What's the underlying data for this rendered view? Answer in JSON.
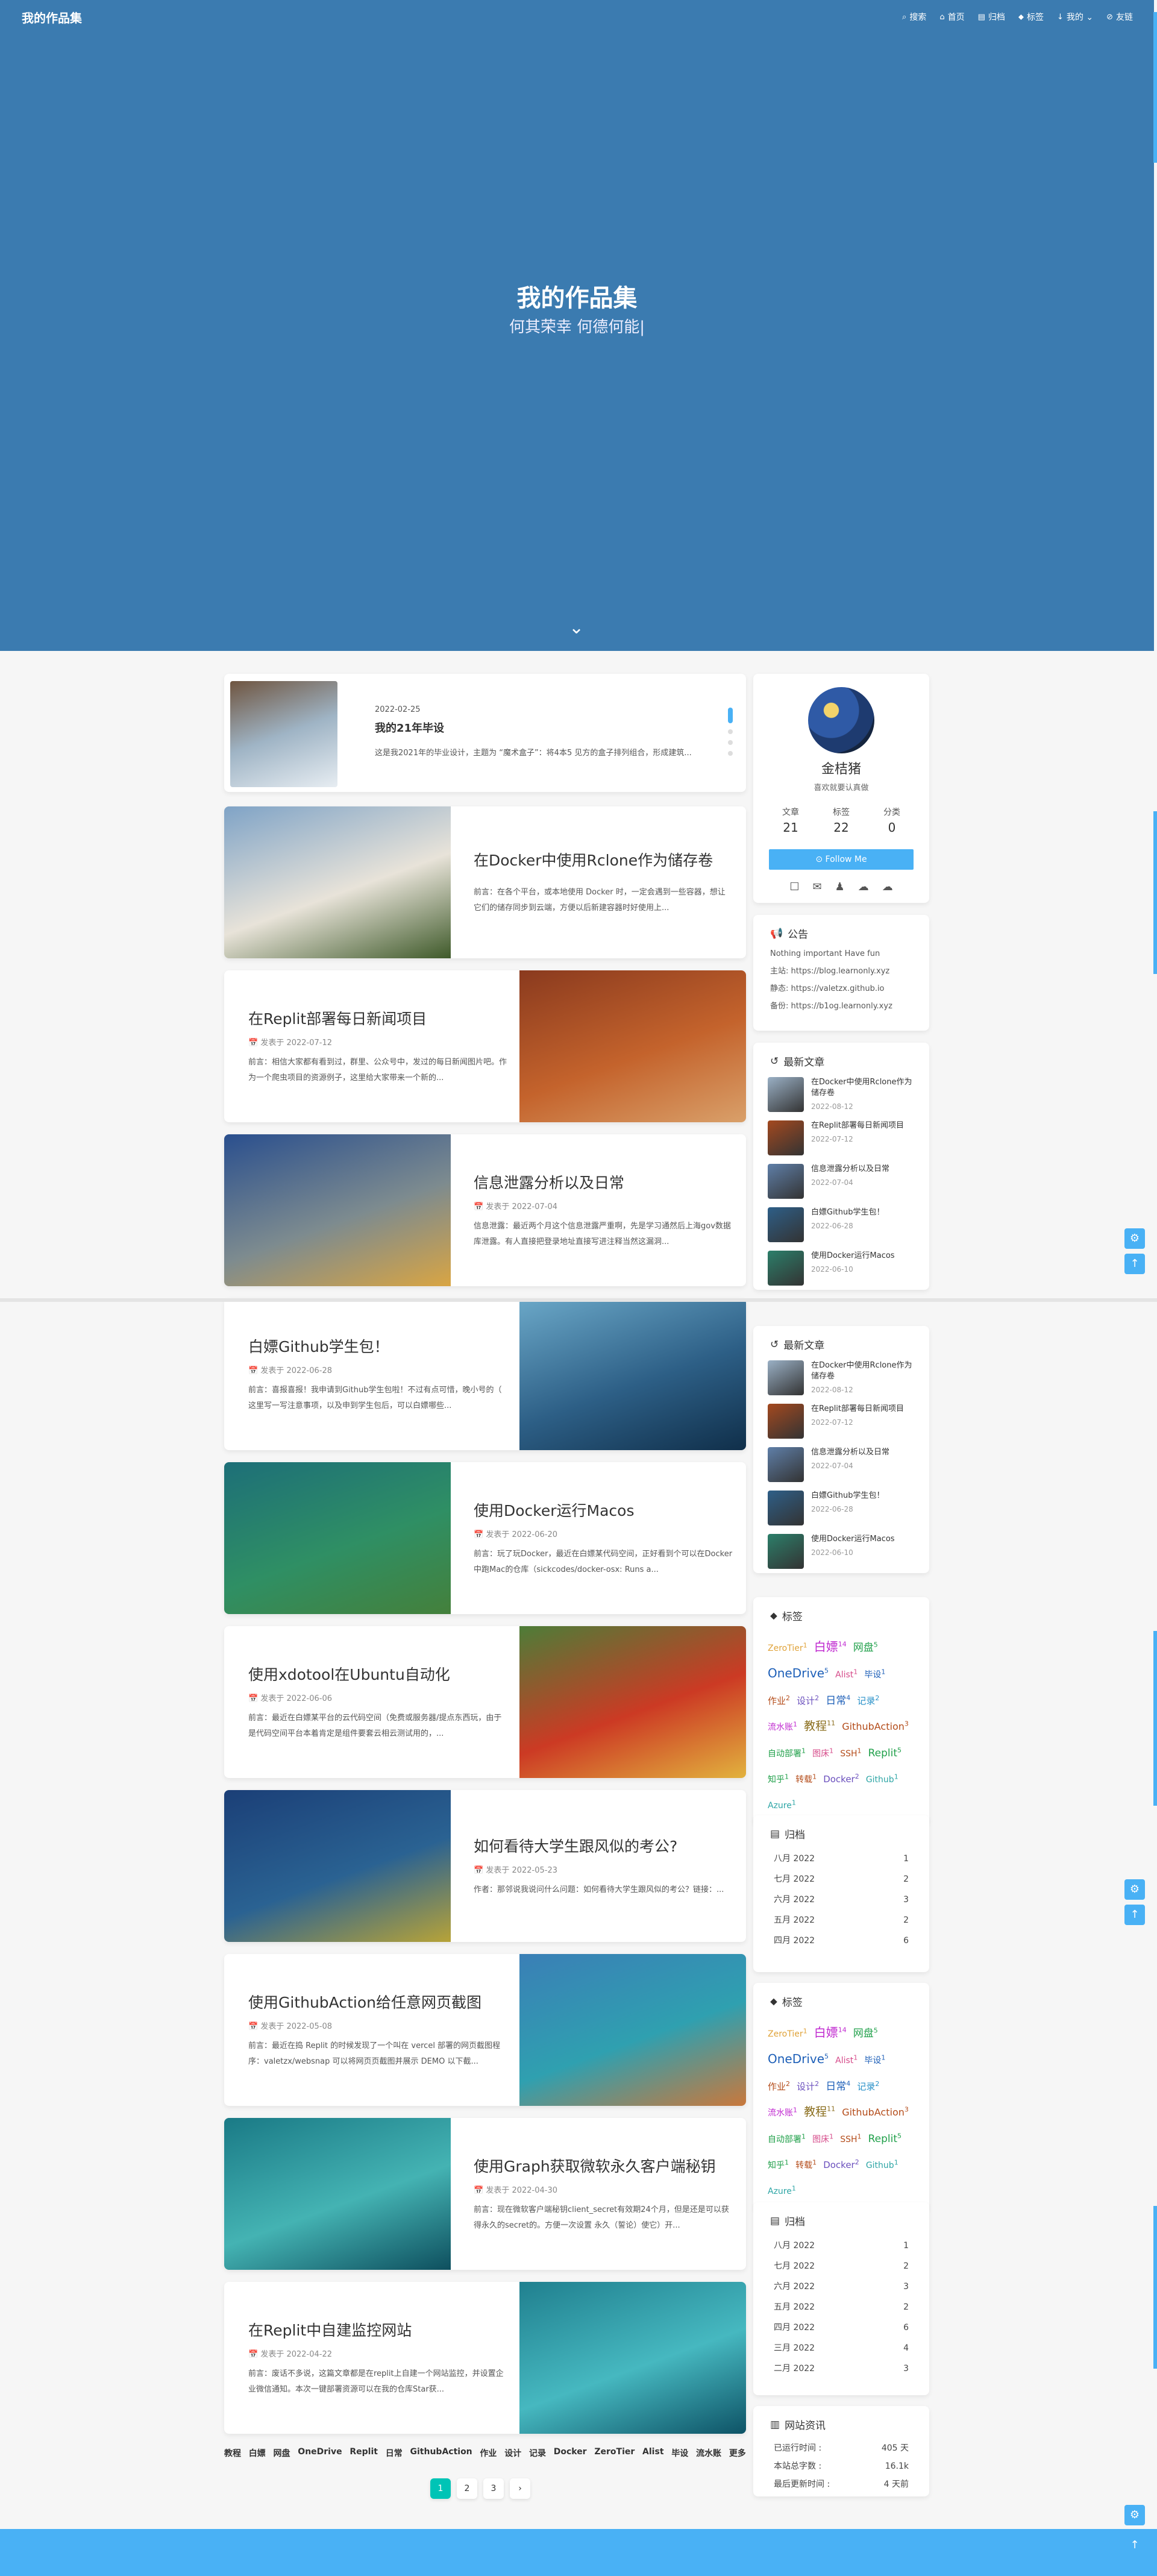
{
  "site": {
    "brand": "我的作品集"
  },
  "nav": [
    {
      "icon": "⌕",
      "label": "搜索"
    },
    {
      "icon": "⌂",
      "label": "首页"
    },
    {
      "icon": "▤",
      "label": "归档"
    },
    {
      "icon": "⬥",
      "label": "标签"
    },
    {
      "icon": "↓",
      "label": "我的 ⌄"
    },
    {
      "icon": "⊘",
      "label": "友链"
    }
  ],
  "hero": {
    "title": "我的作品集",
    "subtitle": "何其荣幸 何德何能|",
    "down_icon": "⌄"
  },
  "sticky": {
    "date": "2022-02-25",
    "title": "我的21年毕设",
    "excerpt": "这是我2021年的毕业设计，主题为 “魔术盒子”：将4本5 见方的盒子排列组合，形成建筑..."
  },
  "posts": [
    {
      "title": "在Docker中使用Rclone作为储存卷",
      "meta": "",
      "excerpt": "前言：在各个平台，或本地使用 Docker 时，一定会遇到一些容器，想让它们的储存同步到云端，方便以后新建容器时好使用上...",
      "colors": [
        "#7fa3c6",
        "#e8e3d9",
        "#3f5a2a"
      ]
    },
    {
      "title": "在Replit部署每日新闻项目",
      "meta": "📅 发表于 2022-07-12",
      "excerpt": "前言：相信大家都有看到过，群里、公众号中，发过的每日新闻图片吧。作为一个爬虫项目的资源例子，这里给大家带来一个新的...",
      "colors": [
        "#8a3a1e",
        "#c4632c",
        "#d9a06a"
      ]
    },
    {
      "title": "信息泄露分析以及日常",
      "meta": "📅 发表于 2022-07-04",
      "excerpt": "信息泄露：最近两个月这个信息泄露严重啊，先是学习通然后上海gov数据库泄露。有人直接把登录地址直接写进注释当然这漏洞...",
      "colors": [
        "#2a4f8e",
        "#7d8b8f",
        "#d9a543"
      ]
    },
    {
      "title": "白嫖Github学生包！",
      "meta": "📅 发表于 2022-06-28",
      "excerpt": "前言：喜报喜报！我申请到Github学生包啦！不过有点可惜，晚小号的（ 这里写一写注意事项，以及申到学生包后，可以白嫖哪些...",
      "colors": [
        "#6ba8c8",
        "#2d5f86",
        "#102f4a"
      ]
    },
    {
      "title": "使用Docker运行Macos",
      "meta": "📅 发表于 2022-06-20",
      "excerpt": "前言：玩了玩Docker，最近在白嫖某代码空间，正好看到个可以在Docker中跑Mac的仓库（sickcodes/docker-osx: Runs a...",
      "colors": [
        "#1d6f78",
        "#2f8f64",
        "#44803b"
      ]
    },
    {
      "title": "使用xdotool在Ubuntu自动化",
      "meta": "📅 发表于 2022-06-06",
      "excerpt": "前言：最近在白嫖某平台的云代码空间（免费或服务器/提点东西玩，由于是代码空间平台本着肯定是组件要套云相云测试用的，...",
      "colors": [
        "#4d7d38",
        "#cc3a24",
        "#e2b23e"
      ]
    },
    {
      "title": "如何看待大学生跟风似的考公?",
      "meta": "📅 发表于 2022-05-23",
      "excerpt": "作者：那邻说我说问什么问题：如何看待大学生跟风似的考公？链接：...",
      "colors": [
        "#1b3f77",
        "#2a6292",
        "#b7a338"
      ]
    },
    {
      "title": "使用GithubAction给任意网页截图",
      "meta": "📅 发表于 2022-05-08",
      "excerpt": "前言：最近在捣 Replit 的时候发现了一个叫在 vercel 部署的网页截图程序：valetzx/websnap 可以将网页页截图并展示 DEMO 以下截...",
      "colors": [
        "#3a7fb6",
        "#2fa0b0",
        "#c9783c"
      ]
    },
    {
      "title": "使用Graph获取微软永久客户端秘钥",
      "meta": "📅 发表于 2022-04-30",
      "excerpt": "前言：现在微软客户端秘钥client_secret有效期24个月，但是还是可以获得永久的secret的。方便一次设置 永久（誓论）使它）开...",
      "colors": [
        "#1a7a86",
        "#44b3b3",
        "#0e4f5e"
      ]
    },
    {
      "title": "在Replit中自建监控网站",
      "meta": "📅 发表于 2022-04-22",
      "excerpt": "前言：废话不多说，这篇文章都是在replit上自建一个网站监控，并设置企业微信通知。本次一键部署资源可以在我的仓库Star获...",
      "colors": [
        "#20808f",
        "#46b8c0",
        "#0e5366"
      ]
    }
  ],
  "author": {
    "name": "金桔猪",
    "desc": "喜欢就要认真做",
    "stats": [
      {
        "k": "文章",
        "v": "21"
      },
      {
        "k": "标签",
        "v": "22"
      },
      {
        "k": "分类",
        "v": "0"
      }
    ],
    "follow": "⊙ Follow Me",
    "socials": [
      "☐",
      "✉",
      "♟",
      "☁",
      "☁"
    ]
  },
  "announce": {
    "head": "公告",
    "lines": [
      "Nothing important Have fun",
      "主站: https://blog.learnonly.xyz",
      "静态: https://valetzx.github.io",
      "备份: https://b1og.learnonly.xyz"
    ]
  },
  "recent": {
    "head": "最新文章",
    "items": [
      {
        "title": "在Docker中使用Rclone作为储存卷",
        "date": "2022-08-12",
        "color": "#9ab0c5"
      },
      {
        "title": "在Replit部署每日新闻项目",
        "date": "2022-07-12",
        "color": "#a4491f"
      },
      {
        "title": "信息泄露分析以及日常",
        "date": "2022-07-04",
        "color": "#5f7fa8"
      },
      {
        "title": "白嫖Github学生包！",
        "date": "2022-06-28",
        "color": "#2e5f88"
      },
      {
        "title": "使用Docker运行Macos",
        "date": "2022-06-10",
        "color": "#2c7f6a"
      }
    ]
  },
  "tags": {
    "head": "标签",
    "items": [
      {
        "n": "ZeroTier",
        "c": "1",
        "s": 14,
        "k": "c1"
      },
      {
        "n": "白嫖",
        "c": "14",
        "s": 20,
        "k": "c2"
      },
      {
        "n": "网盘",
        "c": "5",
        "s": 17,
        "k": "c3"
      },
      {
        "n": "OneDrive",
        "c": "5",
        "s": 20,
        "k": "c4"
      },
      {
        "n": "Alist",
        "c": "1",
        "s": 14,
        "k": "c5"
      },
      {
        "n": "毕设",
        "c": "1",
        "s": 14,
        "k": "c4"
      },
      {
        "n": "作业",
        "c": "2",
        "s": 15,
        "k": "c9"
      },
      {
        "n": "设计",
        "c": "2",
        "s": 15,
        "k": "c6"
      },
      {
        "n": "日常",
        "c": "4",
        "s": 17,
        "k": "c4"
      },
      {
        "n": "记录",
        "c": "2",
        "s": 15,
        "k": "c8"
      },
      {
        "n": "流水账",
        "c": "1",
        "s": 14,
        "k": "c2"
      },
      {
        "n": "教程",
        "c": "11",
        "s": 19,
        "k": "c7"
      },
      {
        "n": "GithubAction",
        "c": "3",
        "s": 16,
        "k": "c9"
      },
      {
        "n": "自动部署",
        "c": "1",
        "s": 14,
        "k": "c3"
      },
      {
        "n": "图床",
        "c": "1",
        "s": 14,
        "k": "c5"
      },
      {
        "n": "SSH",
        "c": "1",
        "s": 14,
        "k": "c9"
      },
      {
        "n": "Replit",
        "c": "5",
        "s": 17,
        "k": "c3"
      },
      {
        "n": "知乎",
        "c": "1",
        "s": 14,
        "k": "c3"
      },
      {
        "n": "转载",
        "c": "1",
        "s": 14,
        "k": "c9"
      },
      {
        "n": "Docker",
        "c": "2",
        "s": 15,
        "k": "c6"
      },
      {
        "n": "Github",
        "c": "1",
        "s": 14,
        "k": "c10"
      },
      {
        "n": "Azure",
        "c": "1",
        "s": 14,
        "k": "c10"
      }
    ]
  },
  "archives": {
    "head": "归档",
    "rows": [
      {
        "m": "八月 2022",
        "c": "1"
      },
      {
        "m": "七月 2022",
        "c": "2"
      },
      {
        "m": "六月 2022",
        "c": "3"
      },
      {
        "m": "五月 2022",
        "c": "2"
      },
      {
        "m": "四月 2022",
        "c": "6"
      },
      {
        "m": "三月 2022",
        "c": "4"
      },
      {
        "m": "二月 2022",
        "c": "3"
      }
    ]
  },
  "siteinfo": {
    "head": "网站资讯",
    "rows": [
      {
        "k": "已运行时间 :",
        "v": "405 天"
      },
      {
        "k": "本站总字数 :",
        "v": "16.1k"
      },
      {
        "k": "最后更新时间 :",
        "v": "4 天前"
      }
    ]
  },
  "categories": [
    "教程",
    "白嫖",
    "网盘",
    "OneDrive",
    "Replit",
    "日常",
    "GithubAction",
    "作业",
    "设计",
    "记录",
    "Docker",
    "ZeroTier",
    "Alist",
    "毕设",
    "流水账",
    "更多"
  ],
  "pager": [
    "1",
    "2",
    "3",
    "›"
  ],
  "float": {
    "gear": "⚙",
    "up": "↑"
  }
}
